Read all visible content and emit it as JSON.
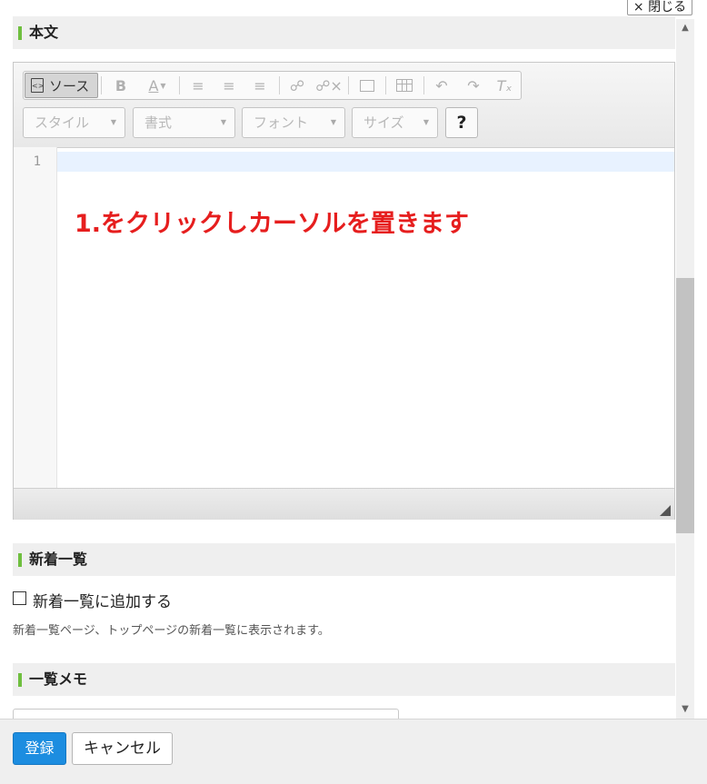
{
  "window": {
    "close_label": "× 閉じる"
  },
  "sections": {
    "body_title": "本文",
    "news_title": "新着一覧",
    "memo_title": "一覧メモ"
  },
  "toolbar": {
    "source_label": "ソース",
    "bold_label": "B",
    "font_color_label": "A",
    "dropdowns": {
      "style": "スタイル",
      "format": "書式",
      "font": "フォント",
      "size": "サイズ"
    },
    "help_label": "?"
  },
  "editor": {
    "line_number": "1",
    "annotation": "1.をクリックしカーソルを置きます"
  },
  "news": {
    "checkbox_label": "新着一覧に追加する",
    "checked": false,
    "help_text": "新着一覧ページ、トップページの新着一覧に表示されます。"
  },
  "memo": {
    "value": ""
  },
  "footer": {
    "register_label": "登録",
    "cancel_label": "キャンセル"
  },
  "colors": {
    "accent": "#1c8de0",
    "section_marker": "#6fbf3f",
    "annotation": "#e61e1e"
  }
}
